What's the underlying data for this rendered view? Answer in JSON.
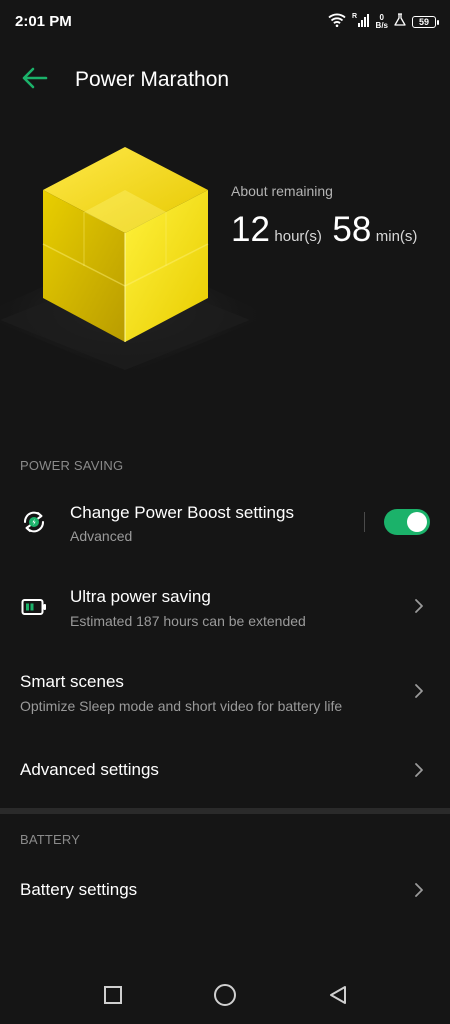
{
  "status_bar": {
    "time": "2:01 PM",
    "net_speed_value": "0",
    "net_speed_unit": "B/s",
    "battery_level": "59",
    "icons": [
      "wifi-icon",
      "signal-icon",
      "lab-icon",
      "battery-icon"
    ]
  },
  "app_bar": {
    "title": "Power Marathon",
    "back_icon": "arrow-left-icon"
  },
  "hero": {
    "label": "About remaining",
    "hours_value": "12",
    "hours_unit": "hour(s)",
    "minutes_value": "58",
    "minutes_unit": "min(s)"
  },
  "power_saving": {
    "header": "POWER SAVING",
    "items": [
      {
        "title": "Change Power Boost settings",
        "subtitle": "Advanced",
        "icon": "power-boost-icon",
        "toggle_on": true
      },
      {
        "title": "Ultra power saving",
        "subtitle": "Estimated 187 hours can be extended",
        "icon": "battery-low-icon"
      },
      {
        "title": "Smart scenes",
        "subtitle": "Optimize Sleep mode and short video for battery life"
      },
      {
        "title": "Advanced settings"
      }
    ]
  },
  "battery": {
    "header": "BATTERY",
    "items": [
      {
        "title": "Battery settings"
      }
    ]
  },
  "nav_bar": {
    "buttons": [
      "recents-square-icon",
      "home-circle-icon",
      "back-triangle-icon"
    ]
  },
  "colors": {
    "background": "#151515",
    "accent_green": "#1bb26a",
    "cube_yellow": "#f2d800",
    "secondary_text": "#9a9a9a",
    "section_header": "#8a8a8a"
  }
}
